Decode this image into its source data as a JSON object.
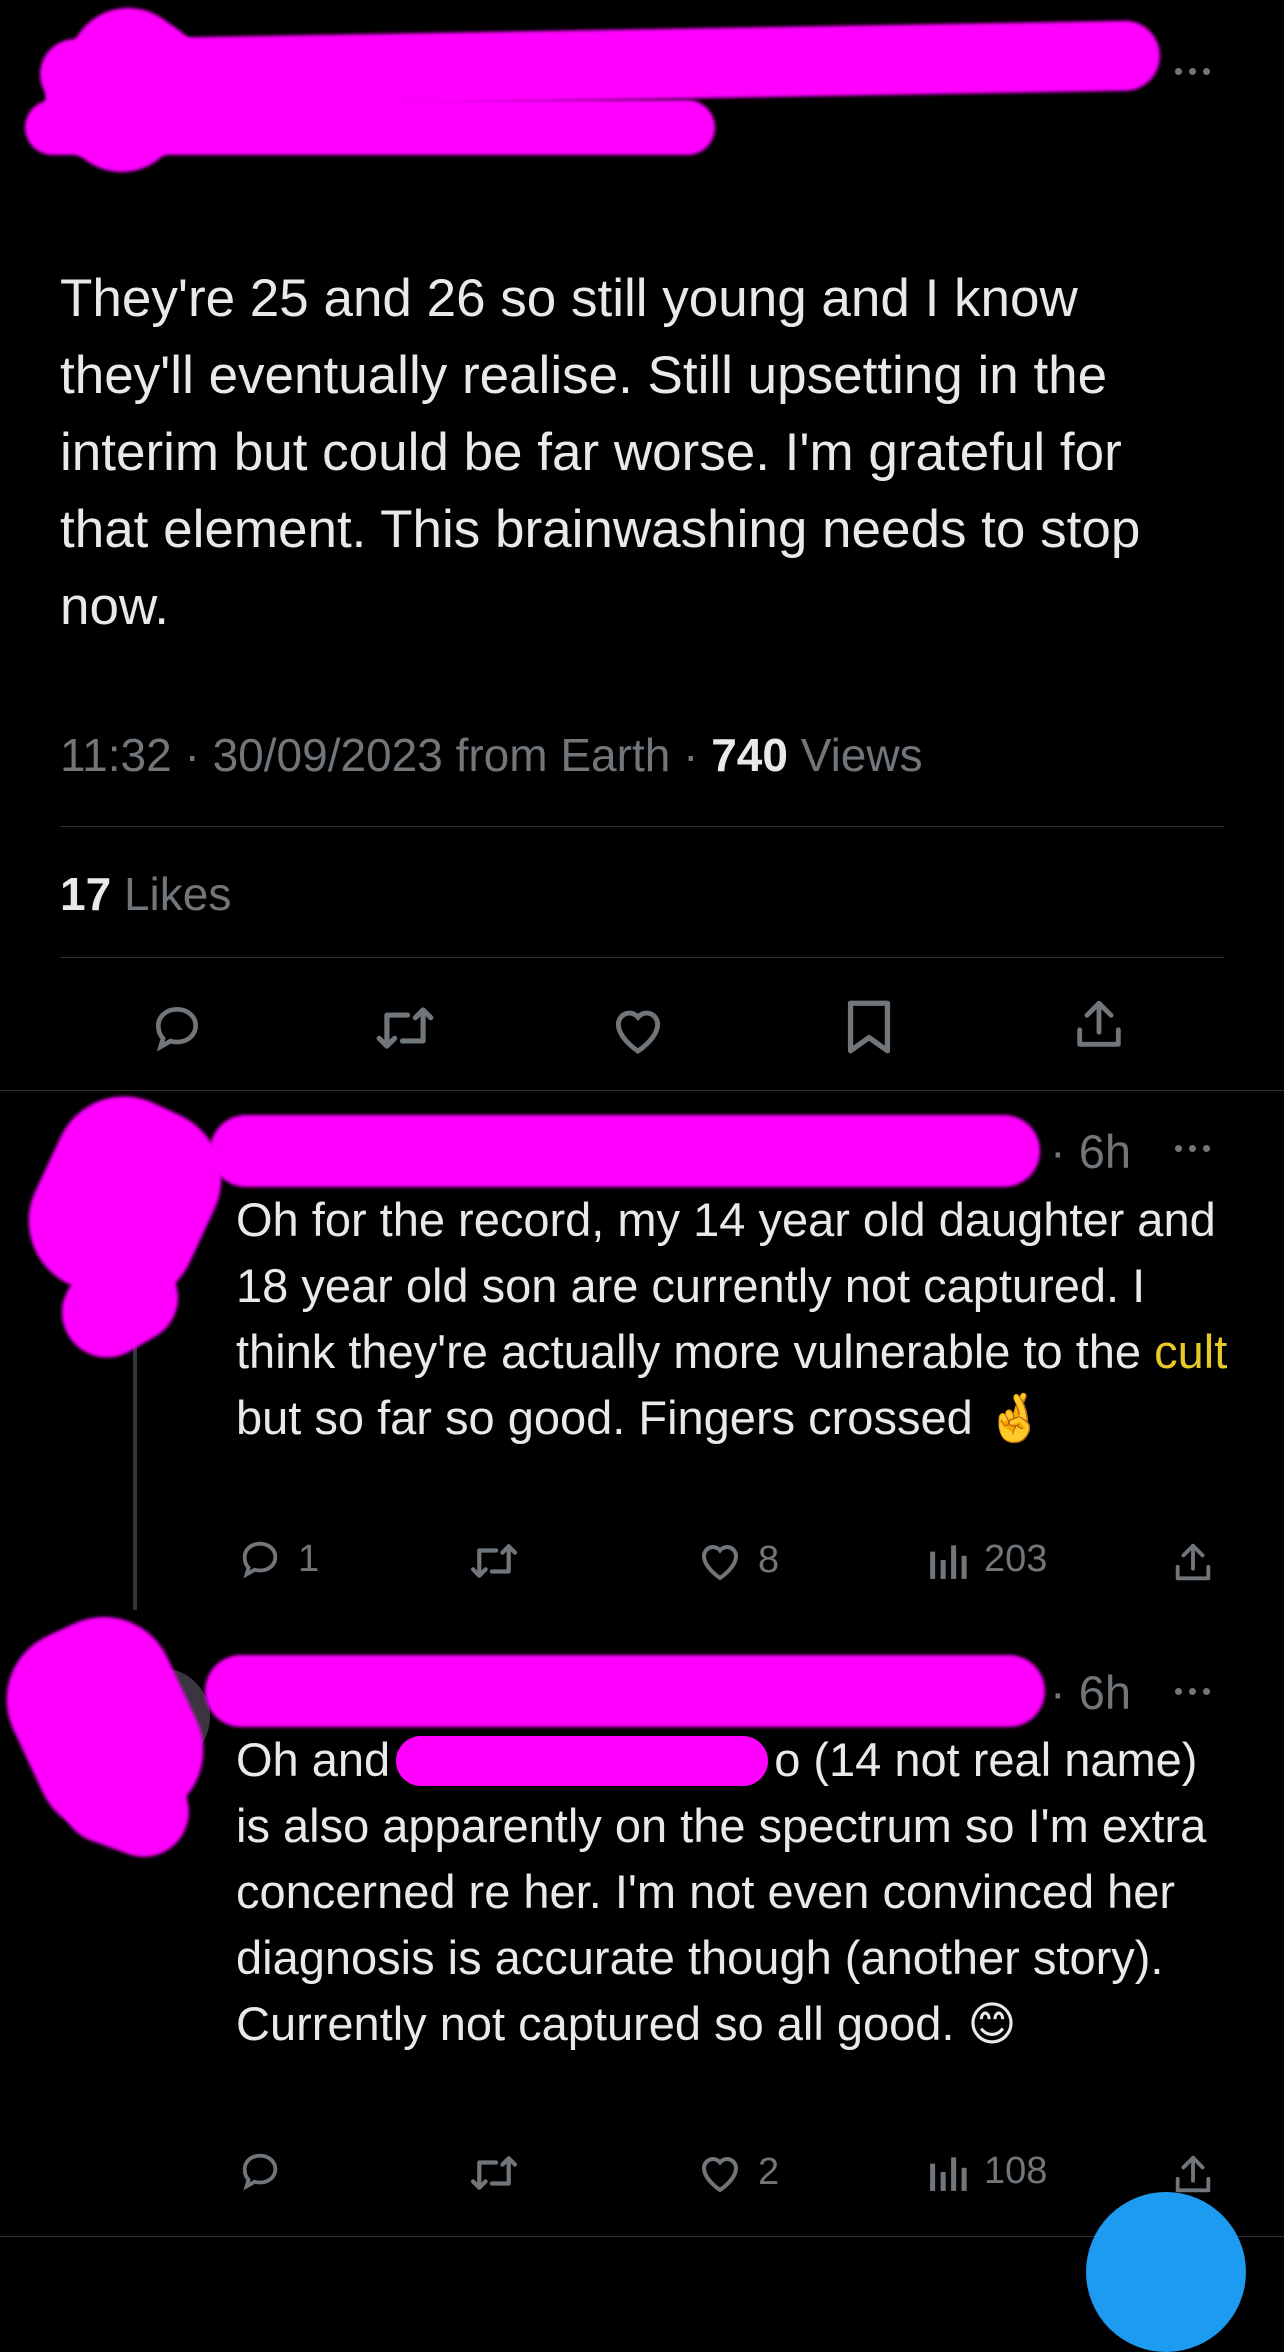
{
  "tweet": {
    "text": "They're 25 and 26 so still young and I know they'll eventually realise. Still upsetting in the interim but could be far worse. I'm grateful for that element. This brainwashing needs to stop now.",
    "time": "11:32 · 30/09/2023 from Earth · ",
    "views_count": "740",
    "views_label": " Views",
    "likes_count": "17",
    "likes_label": " Likes"
  },
  "replies": [
    {
      "time": "· 6h",
      "text_before": "Oh for the record, my 14 year old daughter and 18 year old son are currently not captured. I think they're actually more vulnerable to the ",
      "highlight": "cult",
      "text_after": " but so far so good. Fingers crossed ",
      "emoji": "🤞",
      "reply_count": "1",
      "retweet_count": "",
      "like_count": "8",
      "view_count": "203"
    },
    {
      "time": "· 6h",
      "text_line1_prefix": "Oh and",
      "text_line1_suffix": "o (14 not real",
      "text_rest": "name) is also apparently on the spectrum so I'm extra concerned re her. I'm not even convinced her diagnosis is accurate though (another story). Currently not captured so all good. ",
      "emoji": "😊",
      "reply_count": "",
      "retweet_count": "",
      "like_count": "2",
      "view_count": "108"
    }
  ],
  "icons": {
    "reply": "reply-icon",
    "retweet": "retweet-icon",
    "like": "heart-icon",
    "bookmark": "bookmark-icon",
    "share": "share-icon",
    "views": "views-icon",
    "more": "more-icon"
  },
  "colors": {
    "background": "#000000",
    "text": "#e7e9ea",
    "muted": "#71767b",
    "redaction": "#ff00ff",
    "highlight": "#e7c92a",
    "accent": "#1d9bf0"
  }
}
